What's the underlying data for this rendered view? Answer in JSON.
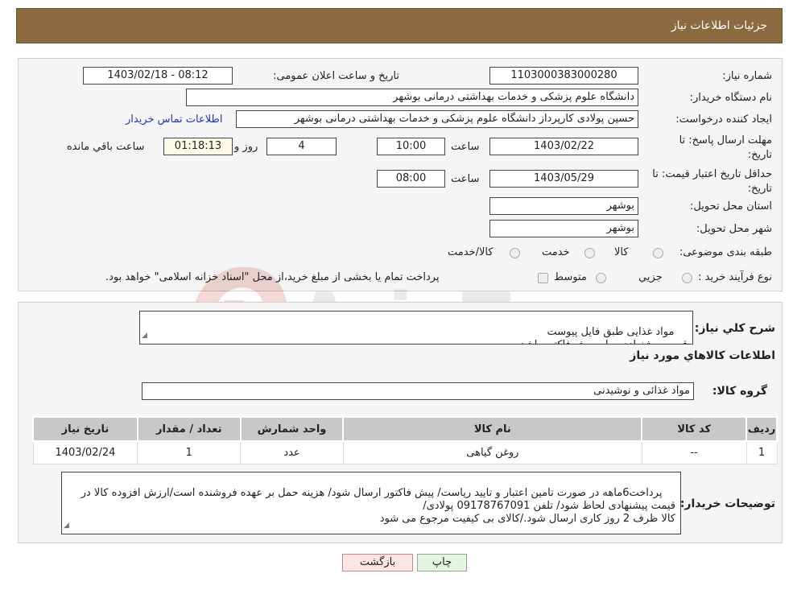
{
  "header": {
    "title": "جزئیات اطلاعات نیاز"
  },
  "form": {
    "need_number_label": "شماره نیاز:",
    "need_number": "1103000383000280",
    "announce_label": "تاریخ و ساعت اعلان عمومی:",
    "announce_value": "1403/02/18 - 08:12",
    "buyer_org_label": "نام دستگاه خریدار:",
    "buyer_org": "دانشگاه علوم پزشکی و خدمات بهداشتی درمانی بوشهر",
    "requester_label": "ایجاد کننده درخواست:",
    "requester": "حسین پولادی کارپرداز دانشگاه علوم پزشکی و خدمات بهداشتی درمانی بوشهر",
    "contact_link": "اطلاعات تماس خریدار",
    "reply_deadline_label": "مهلت ارسال پاسخ: تا تاریخ:",
    "reply_date": "1403/02/22",
    "time_label": "ساعت",
    "reply_time": "10:00",
    "days": "4",
    "days_label": "روز و",
    "remaining": "01:18:13",
    "remaining_label": "ساعت باقي مانده",
    "price_valid_label": "حداقل تاریخ اعتبار قیمت: تا تاریخ:",
    "price_date": "1403/05/29",
    "price_time": "08:00",
    "province_label": "استان محل تحویل:",
    "province": "بوشهر",
    "city_label": "شهر محل تحویل:",
    "city": "بوشهر",
    "category_label": "طبقه بندی موضوعی:",
    "category_options": [
      "کالا",
      "خدمت",
      "کالا/خدمت"
    ],
    "purchase_type_label": "نوع فرآیند خرید :",
    "purchase_options": [
      "جزیي",
      "متوسط"
    ],
    "purchase_note": "پرداخت تمام یا بخشی از مبلغ خرید،از محل \"اسناد خزانه اسلامی\" خواهد بود."
  },
  "summary": {
    "desc_label": "شرح کلي نیاز:",
    "desc_text": "مواد غذایی طبق فایل پیوست\nقیمت پیشنهادی برابر پیش فاکتور باشد",
    "goods_info_title": "اطلاعات کالاهاي مورد نیاز",
    "group_label": "گروه کالا:",
    "group_value": "مواد غذائی و نوشیدنی"
  },
  "table": {
    "headers": [
      "ردیف",
      "کد کالا",
      "نام کالا",
      "واحد شمارش",
      "تعداد / مقدار",
      "تاریخ نیاز"
    ],
    "rows": [
      [
        "1",
        "--",
        "روغن گیاهی",
        "عدد",
        "1",
        "1403/02/24"
      ]
    ]
  },
  "buyer_notes": {
    "label": "توضیحات خریدار:",
    "text": "پرداخت6ماهه در صورت تامین اعتبار و تایید ریاست/ پیش فاکتور ارسال شود/ هزینه حمل بر عهده فروشنده است/ارزش افزوده کالا در قیمت پیشنهادی لحاظ شود/ تلفن 09178767091 پولادی/\nکالا ظرف 2 روز کاری ارسال شود./کالای بی کیفیت مرجوع می شود"
  },
  "buttons": {
    "back": "بازگشت",
    "print": "چاپ"
  },
  "colors": {
    "header_bg": "#8b6a3f",
    "link": "#1a35c9",
    "back_bg": "#fde5e5",
    "print_bg": "#e4f6df"
  }
}
